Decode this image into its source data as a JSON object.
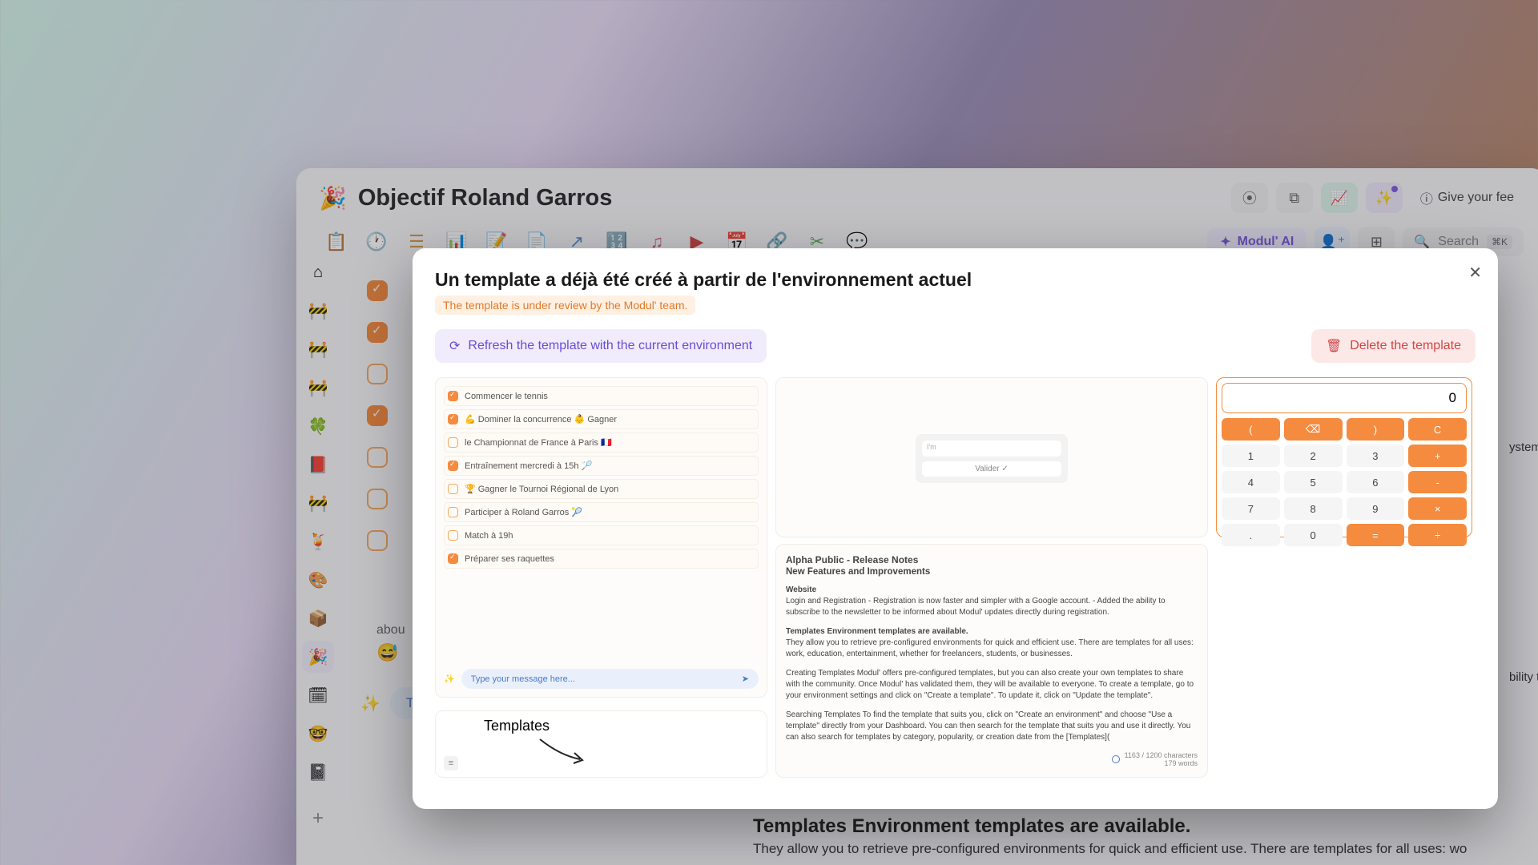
{
  "app": {
    "emoji": "🎉",
    "title": "Objectif Roland Garros",
    "feedback": "Give your fee",
    "search_placeholder": "Search",
    "kbd": "⌘K",
    "ai_label": "Modul' AI"
  },
  "bg": {
    "about": "abou",
    "msg_placeholder": "Type your message here...",
    "templates_title": "Templates Environment templates are available.",
    "templates_sub": "They allow you to retrieve pre-configured environments for quick and efficient use. There are templates for all uses: wo",
    "side_cut": "ystem",
    "side_cut2": "bility tc"
  },
  "modal": {
    "title": "Un template a déjà été créé à partir de l'environnement actuel",
    "review_notice": "The template is under review by the Modul' team.",
    "refresh": "Refresh the template with the current environment",
    "delete": "Delete the template"
  },
  "tasks": [
    {
      "checked": true,
      "label": "Commencer le tennis"
    },
    {
      "checked": true,
      "label": "💪 Dominer la concurrence  👶 Gagner"
    },
    {
      "checked": false,
      "label": "le Championnat de France à Paris 🇫🇷"
    },
    {
      "checked": true,
      "label": "Entraînement mercredi à 15h 🏸"
    },
    {
      "checked": false,
      "label": "🏆 Gagner le Tournoi Régional de Lyon"
    },
    {
      "checked": false,
      "label": "Participer à Roland Garros 🎾"
    },
    {
      "checked": false,
      "label": "Match à 19h"
    },
    {
      "checked": true,
      "label": "Préparer ses raquettes"
    }
  ],
  "mini_chat": {
    "placeholder": "Type your message here..."
  },
  "whiteboard": {
    "text": "Templates"
  },
  "validate": {
    "input": "I'm",
    "button": "Valider  ✓"
  },
  "notes": {
    "title": "Alpha Public - Release Notes",
    "subtitle": "New Features and Improvements",
    "web_h": "Website",
    "web_p": "Login and Registration - Registration is now faster and simpler with a Google account.  - Added the ability to subscribe to the newsletter to be informed about Modul' updates directly during registration.",
    "tpl_h": "Templates Environment templates are available.",
    "tpl_p": "They allow you to retrieve pre-configured environments for quick and efficient use. There are templates for all uses: work, education, entertainment, whether for freelancers, students, or businesses.",
    "create_p": "Creating Templates Modul' offers pre-configured templates, but you can also create your own templates to share with the community. Once Modul' has validated them, they will be available to everyone. To create a template, go to your environment settings and click on \"Create a template\". To update it, click on \"Update the template\".",
    "search_p": "Searching Templates To find the template that suits you, click on \"Create an environment\" and choose \"Use a template\" directly from your Dashboard. You can then search for the template that suits you and use it directly. You can also search for templates by category, popularity, or creation date from the [Templates](",
    "chars": "1163 / 1200 characters",
    "words": "179 words"
  },
  "calc": {
    "display": "0",
    "keys": [
      {
        "l": "(",
        "op": true
      },
      {
        "l": "⌫",
        "op": true
      },
      {
        "l": ")",
        "op": true
      },
      {
        "l": "C",
        "op": true
      },
      {
        "l": "1"
      },
      {
        "l": "2"
      },
      {
        "l": "3"
      },
      {
        "l": "+",
        "op": true
      },
      {
        "l": "4"
      },
      {
        "l": "5"
      },
      {
        "l": "6"
      },
      {
        "l": "-",
        "op": true
      },
      {
        "l": "7"
      },
      {
        "l": "8"
      },
      {
        "l": "9"
      },
      {
        "l": "×",
        "op": true
      },
      {
        "l": "."
      },
      {
        "l": "0"
      },
      {
        "l": "=",
        "op": true
      },
      {
        "l": "÷",
        "op": true
      }
    ]
  }
}
